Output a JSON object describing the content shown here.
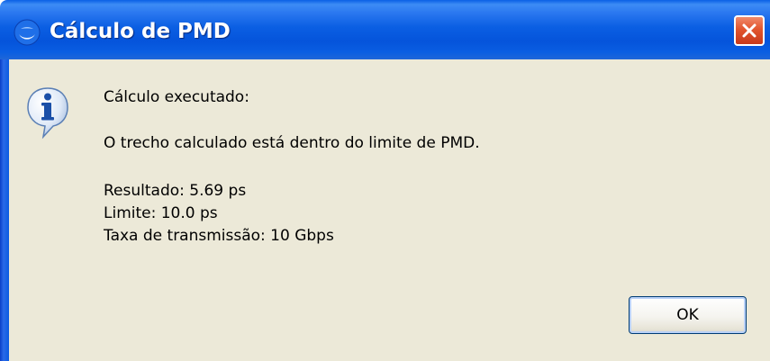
{
  "window": {
    "title": "Cálculo de PMD",
    "app_icon": "java-cup-icon",
    "close_icon": "close-x-icon"
  },
  "message": {
    "icon": "information-icon",
    "heading": "Cálculo executado:",
    "status": "O trecho calculado está dentro do limite de PMD.",
    "result": "Resultado: 5.69 ps",
    "limit": "Limite: 10.0 ps",
    "rate": "Taxa de transmissão: 10 Gbps"
  },
  "buttons": {
    "ok_label": "OK"
  },
  "colors": {
    "titlebar": "#0554db",
    "dialog_background": "#ece9d8",
    "close_button": "#e2552e",
    "button_focus": "#b9d1f7"
  }
}
